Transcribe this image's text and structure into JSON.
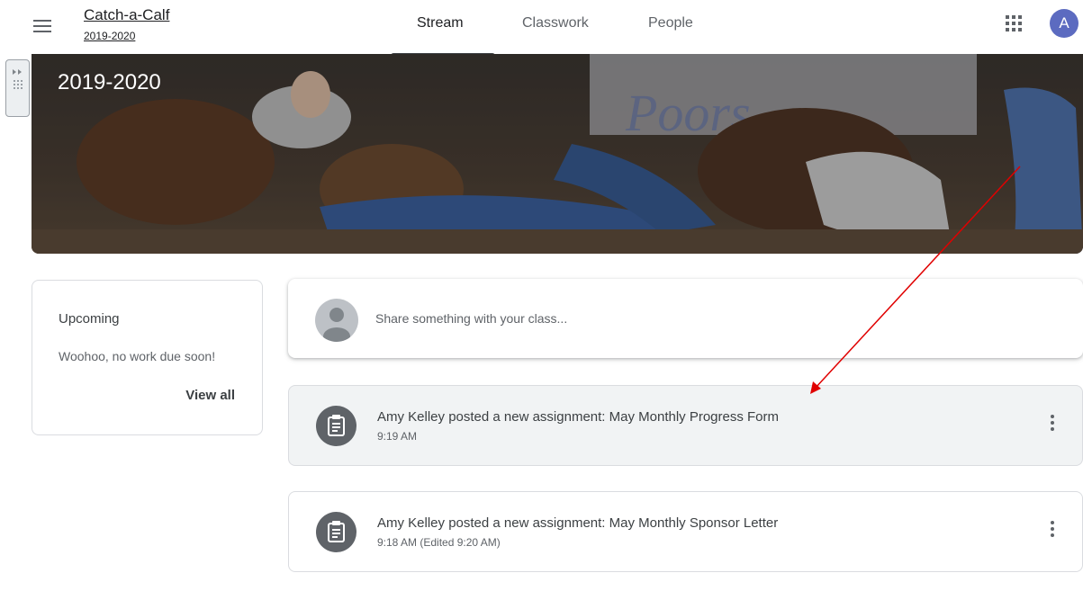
{
  "header": {
    "course_title": "Catch-a-Calf",
    "course_subtitle": "2019-2020",
    "tabs": [
      {
        "label": "Stream",
        "active": true
      },
      {
        "label": "Classwork",
        "active": false
      },
      {
        "label": "People",
        "active": false
      }
    ],
    "avatar_letter": "A"
  },
  "banner": {
    "title": "2019-2020"
  },
  "upcoming": {
    "title": "Upcoming",
    "empty_message": "Woohoo, no work due soon!",
    "view_all": "View all"
  },
  "share": {
    "placeholder": "Share something with your class..."
  },
  "posts": [
    {
      "title": "Amy Kelley posted a new assignment: May Monthly Progress Form",
      "time": "9:19 AM"
    },
    {
      "title": "Amy Kelley posted a new assignment: May Monthly Sponsor Letter",
      "time": "9:18 AM (Edited 9:20 AM)"
    }
  ],
  "colors": {
    "avatar": "#5c6bc0",
    "annotation_arrow": "#e00000"
  }
}
